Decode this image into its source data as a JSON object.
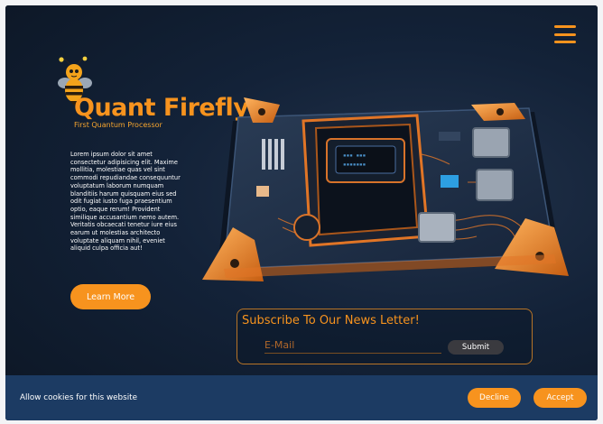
{
  "brand": {
    "title": "Quant Firefly",
    "subtitle": "First Quantum Processor",
    "logo_icon": "bee-icon"
  },
  "nav": {
    "menu_icon": "hamburger-menu-icon"
  },
  "intro": {
    "text": "Lorem ipsum dolor sit amet consectetur adipisicing elit. Maxime mollitia, molestiae quas vel sint commodi repudiandae consequuntur voluptatum laborum numquam blanditiis harum quisquam eius sed odit fugiat iusto fuga praesentium optio, eaque rerum! Provident similique accusantium nemo autem. Veritatis obcaecati tenetur iure eius earum ut molestias architecto voluptate aliquam nihil, eveniet aliquid culpa officia aut!",
    "cta_label": "Learn More"
  },
  "newsletter": {
    "title": "Subscribe To Our News Letter!",
    "email_placeholder": "E-Mail",
    "submit_label": "Submit"
  },
  "cookie": {
    "text": "Allow cookies for this website",
    "decline_label": "Decline",
    "accept_label": "Accept"
  },
  "colors": {
    "accent": "#f7931e",
    "background": "#0f1b2c",
    "cookie_bar": "#1c3b63"
  }
}
